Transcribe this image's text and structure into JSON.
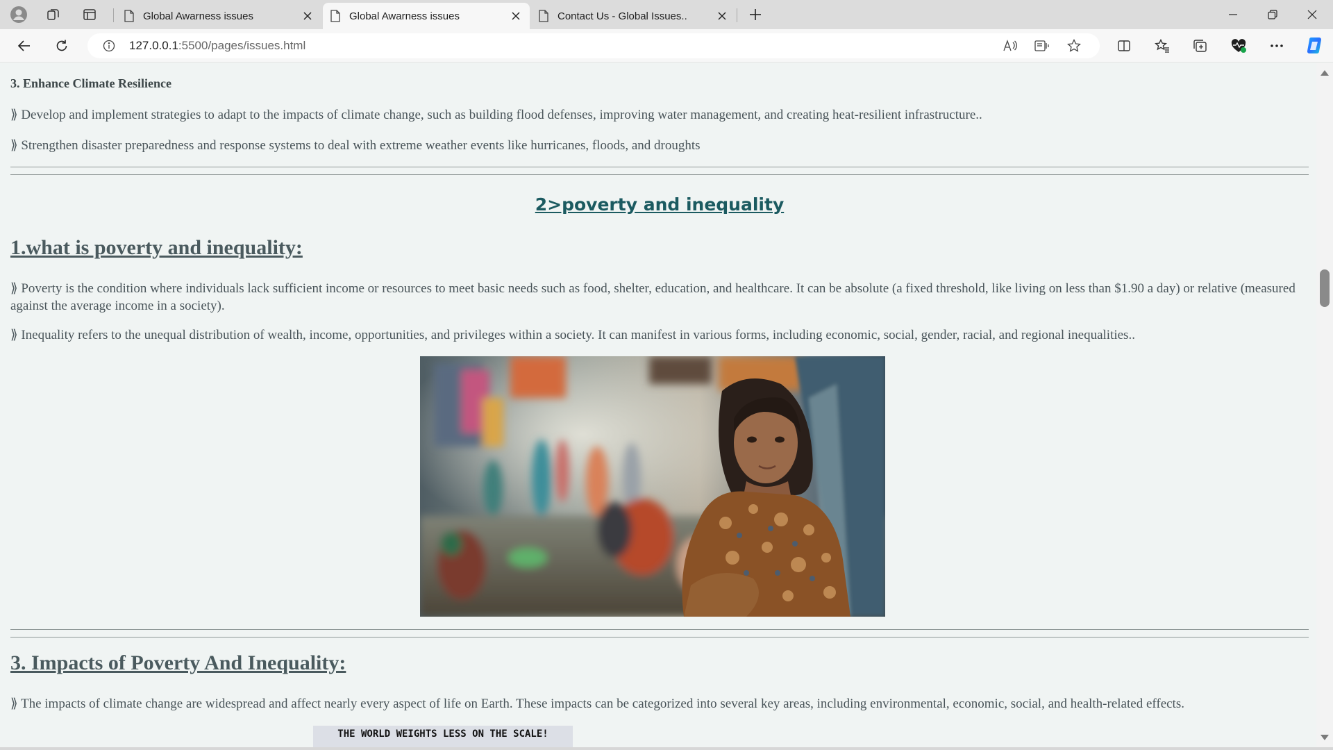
{
  "browser": {
    "tabs": [
      {
        "title": "Global Awarness issues",
        "active": false
      },
      {
        "title": "Global Awarness issues",
        "active": true
      },
      {
        "title": "Contact Us - Global Issues..",
        "active": false
      }
    ],
    "url_host": "127.0.0.1",
    "url_rest": ":5500/pages/issues.html",
    "icons": {
      "profile": "profile-icon",
      "workspaces": "workspaces-icon",
      "tab_actions": "tab-actions-icon",
      "new_tab": "plus-icon",
      "back": "back-arrow-icon",
      "reload": "reload-icon",
      "site_info": "info-icon",
      "read_aloud": "read-aloud-icon",
      "immersive_reader": "immersive-reader-icon",
      "favorite": "star-icon",
      "split_screen": "split-screen-icon",
      "favorites": "favorites-icon",
      "collections": "collections-icon",
      "browser_essentials": "heart-pulse-icon",
      "more": "more-icon",
      "copilot": "copilot-icon"
    }
  },
  "page": {
    "section_heading": "3. Enhance Climate Resilience",
    "resilience_points": [
      "⟫ Develop and implement strategies to adapt to the impacts of climate change, such as building flood defenses, improving water management, and creating heat-resilient infrastructure..",
      "⟫ Strengthen disaster preparedness and response systems to deal with extreme weather events like hurricanes, floods, and droughts"
    ],
    "issue_title": "2>poverty and inequality",
    "what_is_heading": "1.what is poverty and inequality:",
    "what_is_points": [
      "⟫ Poverty is the condition where individuals lack sufficient income or resources to meet basic needs such as food, shelter, education, and healthcare. It can be absolute (a fixed threshold, like living on less than $1.90 a day) or relative (measured against the average income in a society).",
      "⟫ Inequality refers to the unequal distribution of wealth, income, opportunities, and privileges within a society. It can manifest in various forms, including economic, social, gender, racial, and regional inequalities.."
    ],
    "impacts_heading": "3. Impacts of Poverty And Inequality:",
    "impacts_text": "⟫ The impacts of climate change are widespread and affect nearly every aspect of life on Earth. These impacts can be categorized into several key areas, including environmental, economic, social, and health-related effects.",
    "poster_text": "THE WORLD WEIGHTS LESS ON THE SCALE!"
  },
  "colors": {
    "page_bg": "#f0f4f3",
    "title_accent": "#1b5a60",
    "body_text": "#495459"
  }
}
